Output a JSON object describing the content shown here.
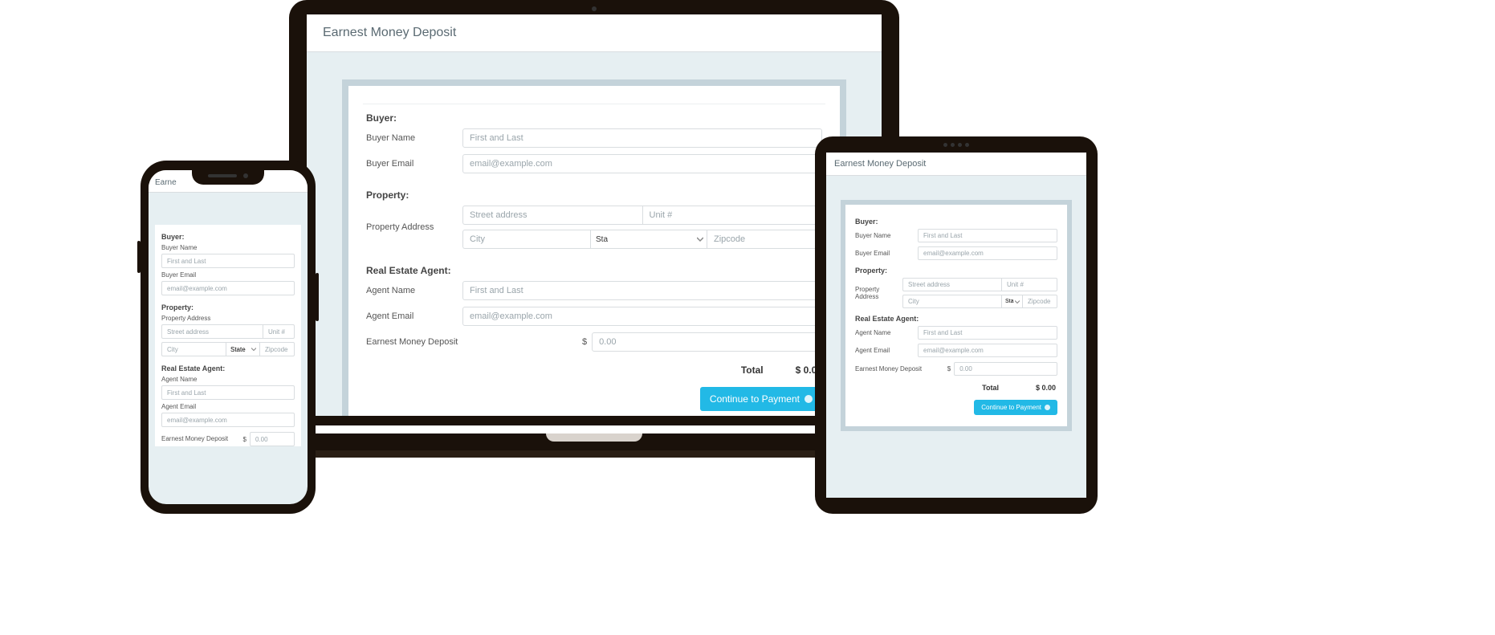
{
  "page_title": "Earnest Money Deposit",
  "buyer": {
    "section": "Buyer:",
    "name_label": "Buyer Name",
    "name_placeholder": "First and Last",
    "email_label": "Buyer Email",
    "email_placeholder": "email@example.com"
  },
  "property": {
    "section": "Property:",
    "address_label": "Property Address",
    "street_placeholder": "Street address",
    "unit_placeholder": "Unit #",
    "city_placeholder": "City",
    "state_placeholder_short": "Sta",
    "state_placeholder_full": "State",
    "state_placeholder_tab": "Sta",
    "zip_placeholder": "Zipcode"
  },
  "agent": {
    "section": "Real Estate Agent:",
    "name_label": "Agent Name",
    "name_placeholder": "First and Last",
    "email_label": "Agent Email",
    "email_placeholder": "email@example.com"
  },
  "deposit": {
    "label": "Earnest Money Deposit",
    "label_phone": "Earnest Money Deposit",
    "currency": "$",
    "amount_placeholder": "0.00"
  },
  "totals": {
    "label": "Total",
    "value": "$ 0.00"
  },
  "cta": {
    "label": "Continue to Payment"
  },
  "phone_title_visible": "Earne"
}
